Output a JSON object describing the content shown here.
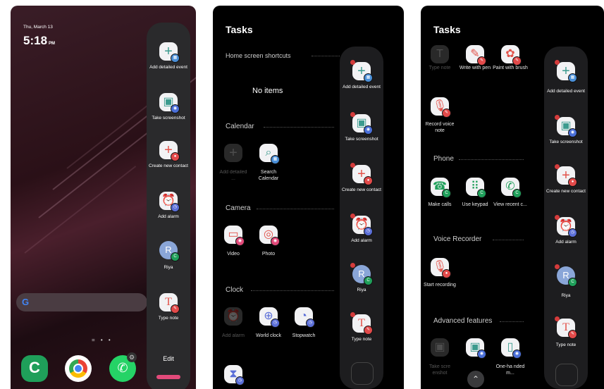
{
  "screen1": {
    "date": "Thu, March 13",
    "time": "5:18",
    "ampm": "PM",
    "panel_items": [
      {
        "label": "Add detailed event",
        "glyph": "+",
        "color": "#3c9b8e",
        "badge": "calendar"
      },
      {
        "label": "Take screenshot",
        "glyph": "▣",
        "color": "#3c9b8e",
        "badge": "camera"
      },
      {
        "label": "Create new contact",
        "glyph": "+",
        "color": "#e2524a",
        "badge": "contacts"
      },
      {
        "label": "Add alarm",
        "glyph": "⏰",
        "color": "#5b6fd8",
        "badge": "clock"
      },
      {
        "label": "Riya",
        "glyph": "R",
        "color": "#8aa6d8",
        "badge": "phone"
      },
      {
        "label": "Type note",
        "glyph": "T",
        "color": "#e2524a",
        "badge": "notes"
      }
    ],
    "edit_label": "Edit",
    "search_letter": "G"
  },
  "screen2": {
    "title": "Tasks",
    "home_section": "Home screen shortcuts",
    "no_items": "No items",
    "calendar_section": "Calendar",
    "calendar_items": [
      {
        "label": "Add detailed ...",
        "dimmed": true
      },
      {
        "label": "Search Calendar",
        "dimmed": false
      }
    ],
    "camera_section": "Camera",
    "camera_items": [
      {
        "label": "Video"
      },
      {
        "label": "Photo"
      }
    ],
    "clock_section": "Clock",
    "clock_items": [
      {
        "label": "Add alarm",
        "dimmed": true
      },
      {
        "label": "World clock",
        "dimmed": false
      },
      {
        "label": "Stopwatch",
        "dimmed": false
      }
    ],
    "panel_items": [
      {
        "label": "Add detailed event"
      },
      {
        "label": "Take screenshot"
      },
      {
        "label": "Create new contact"
      },
      {
        "label": "Add alarm"
      },
      {
        "label": "Riya"
      },
      {
        "label": "Type note"
      }
    ]
  },
  "screen3": {
    "title": "Tasks",
    "top_items": [
      {
        "label": "Type note",
        "dimmed": true
      },
      {
        "label": "Write with pen",
        "dimmed": false
      },
      {
        "label": "Paint with brush",
        "dimmed": false
      }
    ],
    "record_item": "Record voice note",
    "phone_section": "Phone",
    "phone_items": [
      {
        "label": "Make calls"
      },
      {
        "label": "Use keypad"
      },
      {
        "label": "View recent c..."
      }
    ],
    "voice_section": "Voice Recorder",
    "voice_item": "Start recording",
    "advanced_section": "Advanced features",
    "advanced_items": [
      {
        "label": "Take scre enshot",
        "dimmed": true
      },
      {
        "label": "One-ha nded m...",
        "dimmed": false
      }
    ],
    "panel_items": [
      {
        "label": "Add detailed event"
      },
      {
        "label": "Take screenshot"
      },
      {
        "label": "Create new contact"
      },
      {
        "label": "Add alarm"
      },
      {
        "label": "Riya"
      },
      {
        "label": "Type note"
      }
    ]
  }
}
